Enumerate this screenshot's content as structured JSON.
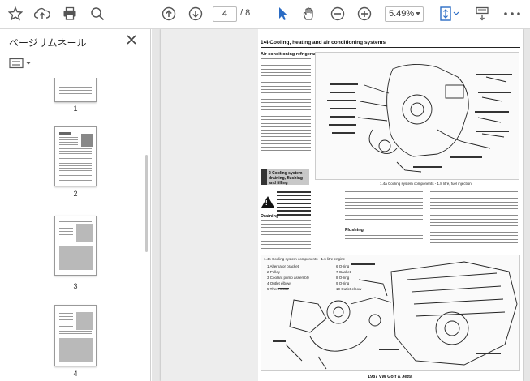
{
  "toolbar": {
    "current_page": "4",
    "page_separator": "/ 8",
    "zoom": "5.49%"
  },
  "sidebar": {
    "title": "ページサムネール",
    "pages": [
      "1",
      "2",
      "3",
      "4"
    ]
  },
  "document": {
    "heading": "1•4 Cooling, heating and air conditioning systems",
    "subheading_1": "Air conditioning refrigerant",
    "section_box": "2 Cooling system - draining, flushing and filling",
    "warning_text": "Warning: Never work on the cooling system when it is hot. Take care to avoid any possibility of scalding",
    "subheading_2": "Draining",
    "subheading_3": "Flushing",
    "figure1_caption": "1.4a Cooling system components - 1.8 litre, fuel injection",
    "figure2_caption": "1.4b Cooling system components - 1.6 litre engine",
    "legend": [
      "1 Alternator bracket",
      "2 Pulley",
      "3 Coolant pump assembly",
      "4 Outlet elbow",
      "5 Thermostat",
      "6 O-ring",
      "7 Gasket",
      "8 O-ring",
      "9 O-ring",
      "10 Outlet elbow"
    ],
    "footer": "1987 VW Golf & Jetta"
  },
  "colors": {
    "accent_blue": "#2b6cc4",
    "toolbar_icon": "#555555"
  }
}
